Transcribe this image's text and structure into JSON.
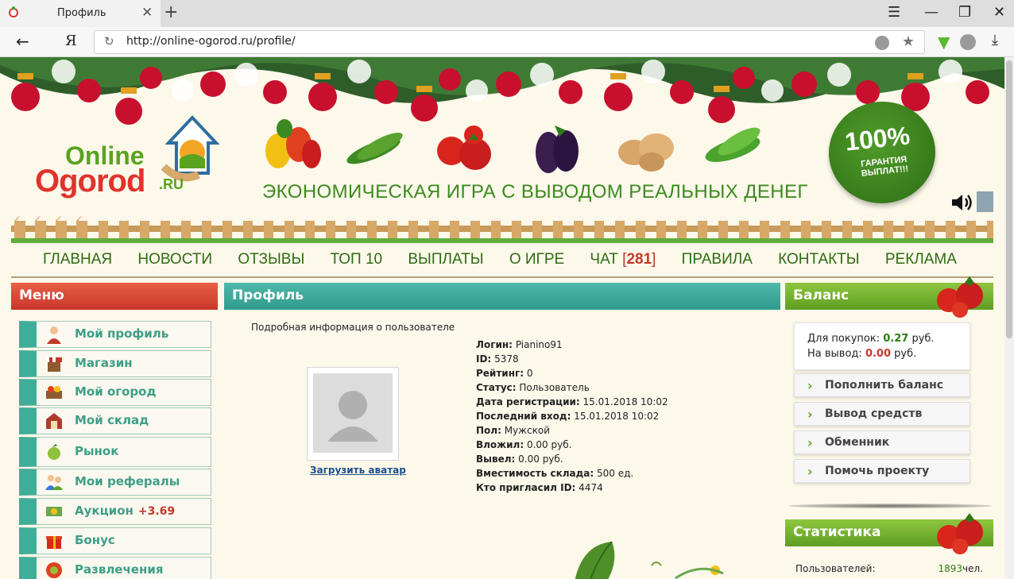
{
  "browser": {
    "tab_title": "Профиль",
    "url": "http://online-ogorod.ru/profile/",
    "ya_label": "Я"
  },
  "site": {
    "logo_online": "Online",
    "logo_ogorod": "Ogorod",
    "logo_ru": ".RU",
    "slogan": "ЭКОНОМИЧЕСКАЯ ИГРА С ВЫВОДОМ РЕАЛЬНЫХ ДЕНЕГ",
    "badge_big": "100%",
    "badge_small": "ГАРАНТИЯ ВЫПЛАТ!!!"
  },
  "nav": {
    "home": "ГЛАВНАЯ",
    "news": "НОВОСТИ",
    "reviews": "ОТЗЫВЫ",
    "top": "ТОП 10",
    "payouts": "ВЫПЛАТЫ",
    "about": "О ИГРЕ",
    "chat": "ЧАТ",
    "chat_count": "281",
    "rules": "ПРАВИЛА",
    "contacts": "КОНТАКТЫ",
    "ads": "РЕКЛАМА"
  },
  "menu": {
    "title": "Меню",
    "profile": "Мой профиль",
    "shop": "Магазин",
    "garden": "Мой огород",
    "warehouse": "Мой склад",
    "market": "Рынок",
    "referrals": "Мои рефералы",
    "auction": "Аукцион",
    "auction_extra": "+3.69",
    "bonus": "Бонус",
    "fun": "Развлечения"
  },
  "profile": {
    "title": "Профиль",
    "subtitle": "Подробная информация о пользователе",
    "upload_avatar": "Загрузить аватар",
    "login_label": "Логин:",
    "login": "Pianino91",
    "id_label": "ID:",
    "id": "5378",
    "rating_label": "Рейтинг:",
    "rating": "0",
    "status_label": "Статус:",
    "status": "Пользователь",
    "reg_label": "Дата регистрации:",
    "reg": "15.01.2018 10:02",
    "last_label": "Последний вход:",
    "last": "15.01.2018 10:02",
    "gender_label": "Пол:",
    "gender": "Мужской",
    "invested_label": "Вложил:",
    "invested": "0.00 руб.",
    "withdrawn_label": "Вывел:",
    "withdrawn": "0.00 руб.",
    "capacity_label": "Вместимость склада:",
    "capacity": "500 ед.",
    "inviter_label": "Кто пригласил ID:",
    "inviter": "4474"
  },
  "balance": {
    "title": "Баланс",
    "buy_label": "Для покупок:",
    "buy_value": "0.27",
    "withdraw_label": "На вывод:",
    "withdraw_value": "0.00",
    "currency": "руб.",
    "topup": "Пополнить баланс",
    "withdraw_btn": "Вывод средств",
    "exchange": "Обменник",
    "help": "Помочь проекту"
  },
  "stats": {
    "title": "Статистика",
    "users_label": "Пользователей:",
    "users_value": "1893",
    "users_unit": "чел."
  },
  "colors": {
    "menu_header": "#e04a3a",
    "profile_header": "#3fae9e",
    "balance_header": "#7cb833",
    "nav_text": "#2f6b12",
    "accent_red": "#c0392b"
  }
}
